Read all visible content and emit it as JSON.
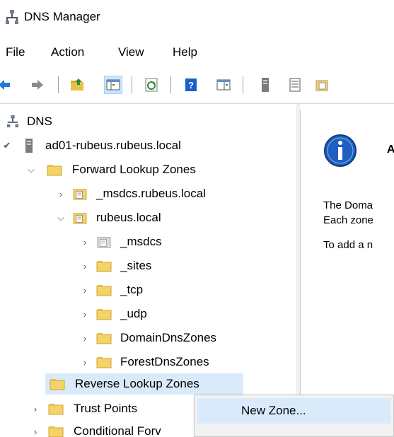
{
  "window": {
    "title": "DNS Manager",
    "icon": "dns-manager-icon"
  },
  "menubar": {
    "items": [
      "File",
      "Action",
      "View",
      "Help"
    ]
  },
  "toolbar": {
    "buttons": [
      "back-icon",
      "forward-icon",
      "up-folder-icon",
      "show-hide-console-tree-icon",
      "refresh-icon",
      "help-icon",
      "console-tree-icon",
      "server-icon",
      "list-icon",
      "properties-icon"
    ]
  },
  "tree": {
    "root": "DNS",
    "server": "ad01-rubeus.rubeus.local",
    "forward_zones": "Forward Lookup Zones",
    "msdcs_zone": "_msdcs.rubeus.local",
    "rubeus_zone": "rubeus.local",
    "children": [
      "_msdcs",
      "_sites",
      "_tcp",
      "_udp",
      "DomainDnsZones",
      "ForestDnsZones"
    ],
    "reverse_zones": "Reverse Lookup Zones",
    "trust_points": "Trust Points",
    "conditional_forwarders": "Conditional Forv"
  },
  "detail": {
    "title": "A",
    "line1": "The Doma",
    "line2": "Each zone",
    "line3": "To add a n"
  },
  "context_menu": {
    "item": "New Zone..."
  },
  "colors": {
    "selection": "#d9ebfb",
    "folder": "#f6d365",
    "info_blue": "#1f5fbf"
  }
}
